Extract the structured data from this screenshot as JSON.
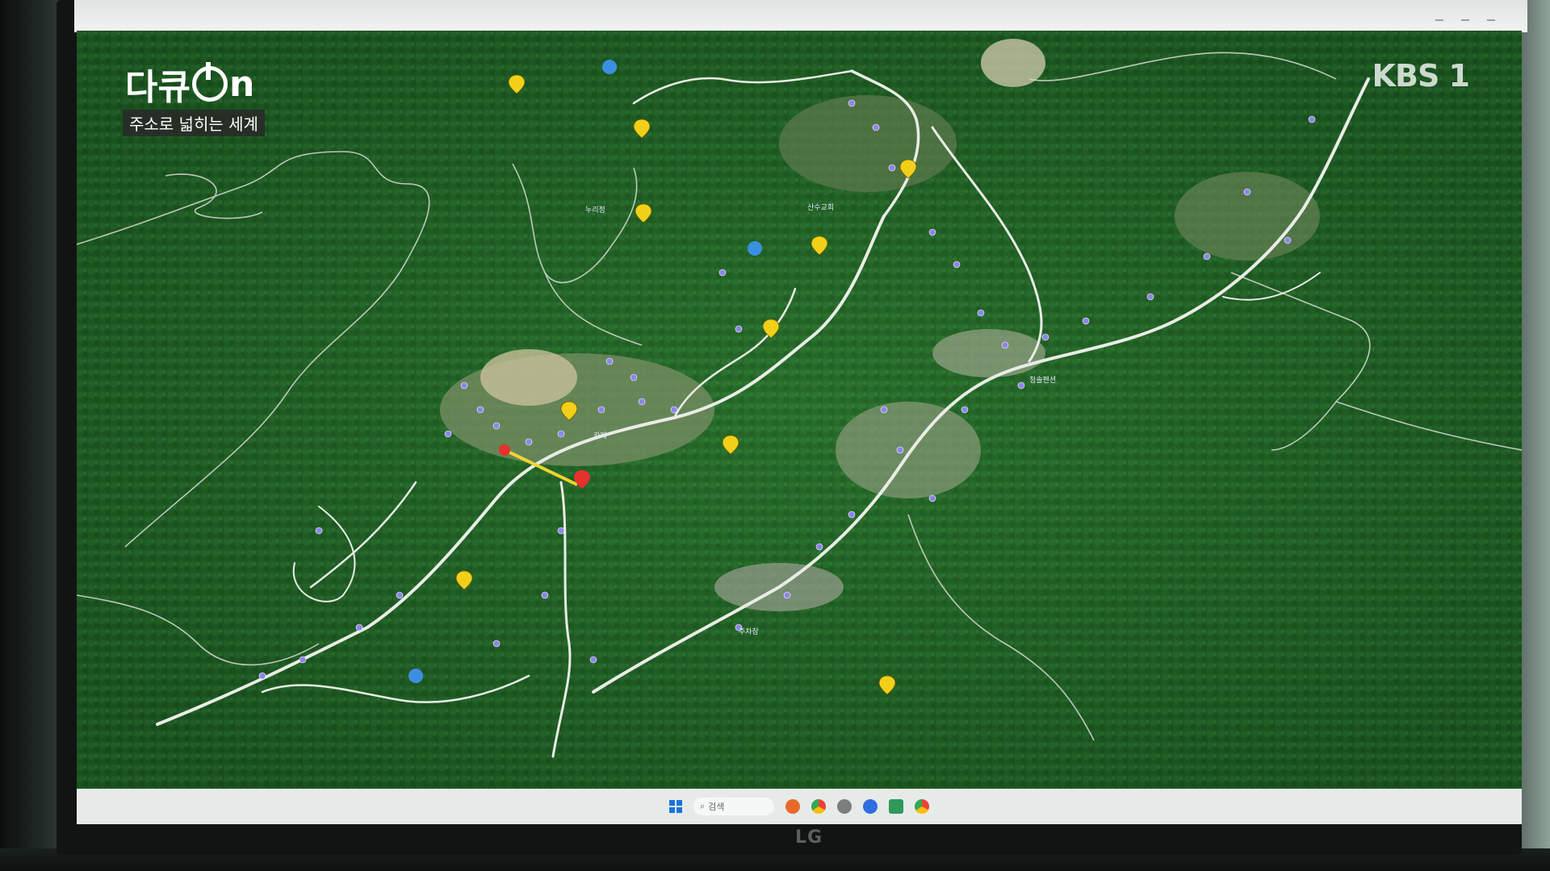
{
  "overlay": {
    "show_logo_left": "다큐",
    "show_logo_right": "n",
    "episode_title": "주소로 넓히는 세계",
    "broadcaster": "KBS 1"
  },
  "monitor": {
    "brand": "LG"
  },
  "taskbar": {
    "search_placeholder": "검색"
  },
  "map": {
    "labels": [
      {
        "text": "누리정"
      },
      {
        "text": "청솔펜션"
      },
      {
        "text": "산수교회"
      },
      {
        "text": "카페"
      },
      {
        "text": "주차장"
      }
    ],
    "colors": {
      "forest": "#1f5a24",
      "road": "#e9ece6",
      "poi_yellow": "#f2d019",
      "poi_red": "#e5322d",
      "route": "#f3d331"
    }
  }
}
